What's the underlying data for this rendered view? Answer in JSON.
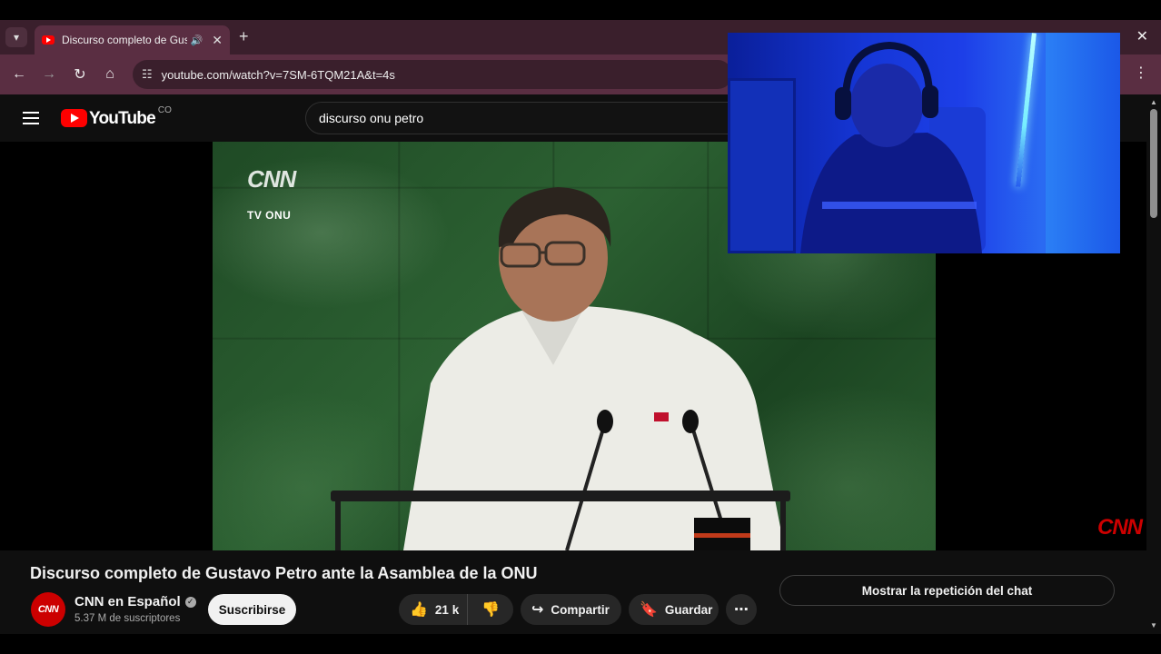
{
  "browser": {
    "tab_title": "Discurso completo de Gustavo",
    "url": "youtube.com/watch?v=7SM-6TQM21A&t=4s",
    "icons": {
      "tab_list": "▾",
      "speaker": "🔊",
      "tab_close": "✕",
      "new_tab": "+",
      "back": "←",
      "forward": "→",
      "reload": "↻",
      "home": "⌂",
      "site_info": "☷",
      "window_close": "✕",
      "menu": "⋮"
    }
  },
  "youtube": {
    "logo_text": "YouTube",
    "country_code": "CO",
    "search_query": "discurso onu petro"
  },
  "video": {
    "overlay_brand": "CNN",
    "overlay_source": "TV ONU",
    "corner_brand": "CNN",
    "title": "Discurso completo de Gustavo Petro ante la Asamblea de la ONU"
  },
  "channel": {
    "avatar_text": "CNN",
    "name": "CNN en Español",
    "verified_mark": "✓",
    "subscribers": "5.37 M de suscriptores",
    "subscribe_label": "Suscribirse"
  },
  "actions": {
    "like_icon": "👍",
    "likes": "21 k",
    "dislike_icon": "👎",
    "share_icon": "↪",
    "share_label": "Compartir",
    "save_icon": "🔖",
    "save_label": "Guardar",
    "more_icon": "⋯",
    "chat_replay_label": "Mostrar la repetición del chat"
  },
  "scrollbar": {
    "up_icon": "▲",
    "down_icon": "▼"
  },
  "colors": {
    "chrome_frame": "#3a1f2c",
    "chrome_toolbar": "#5a2e42",
    "youtube_red": "#ff0000",
    "cnn_red": "#cc0000",
    "page_background": "#0f0f0f"
  }
}
